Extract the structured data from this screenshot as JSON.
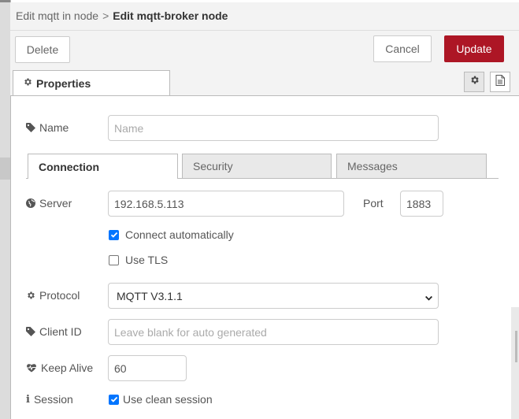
{
  "header": {
    "breadcrumb_prev": "Edit mqtt in node",
    "separator": ">",
    "breadcrumb_current": "Edit mqtt-broker node"
  },
  "toolbar": {
    "delete_label": "Delete",
    "cancel_label": "Cancel",
    "update_label": "Update",
    "update_color": "#ad1625"
  },
  "tabs": {
    "properties_label": "Properties",
    "properties_icon": "gear-icon",
    "settings_icon": "gear-icon",
    "description_icon": "document-icon"
  },
  "form": {
    "name": {
      "label": "Name",
      "icon": "tag-icon",
      "value": "",
      "placeholder": "Name"
    },
    "subtabs": {
      "connection": "Connection",
      "security": "Security",
      "messages": "Messages",
      "active": "Connection"
    },
    "server": {
      "label": "Server",
      "icon": "globe-icon",
      "value": "192.168.5.113"
    },
    "port": {
      "label": "Port",
      "value": "1883"
    },
    "connect_auto": {
      "label": "Connect automatically",
      "checked": true
    },
    "use_tls": {
      "label": "Use TLS",
      "checked": false
    },
    "protocol": {
      "label": "Protocol",
      "icon": "gear-icon",
      "value": "MQTT V3.1.1"
    },
    "client_id": {
      "label": "Client ID",
      "icon": "tag-icon",
      "value": "",
      "placeholder": "Leave blank for auto generated"
    },
    "keep_alive": {
      "label": "Keep Alive",
      "icon": "heartbeat-icon",
      "value": "60"
    },
    "session": {
      "label": "Session",
      "icon": "info-icon",
      "option_label": "Use clean session",
      "checked": true
    }
  },
  "colors": {
    "accent": "#0075ff",
    "primary_button": "#ad1625"
  }
}
